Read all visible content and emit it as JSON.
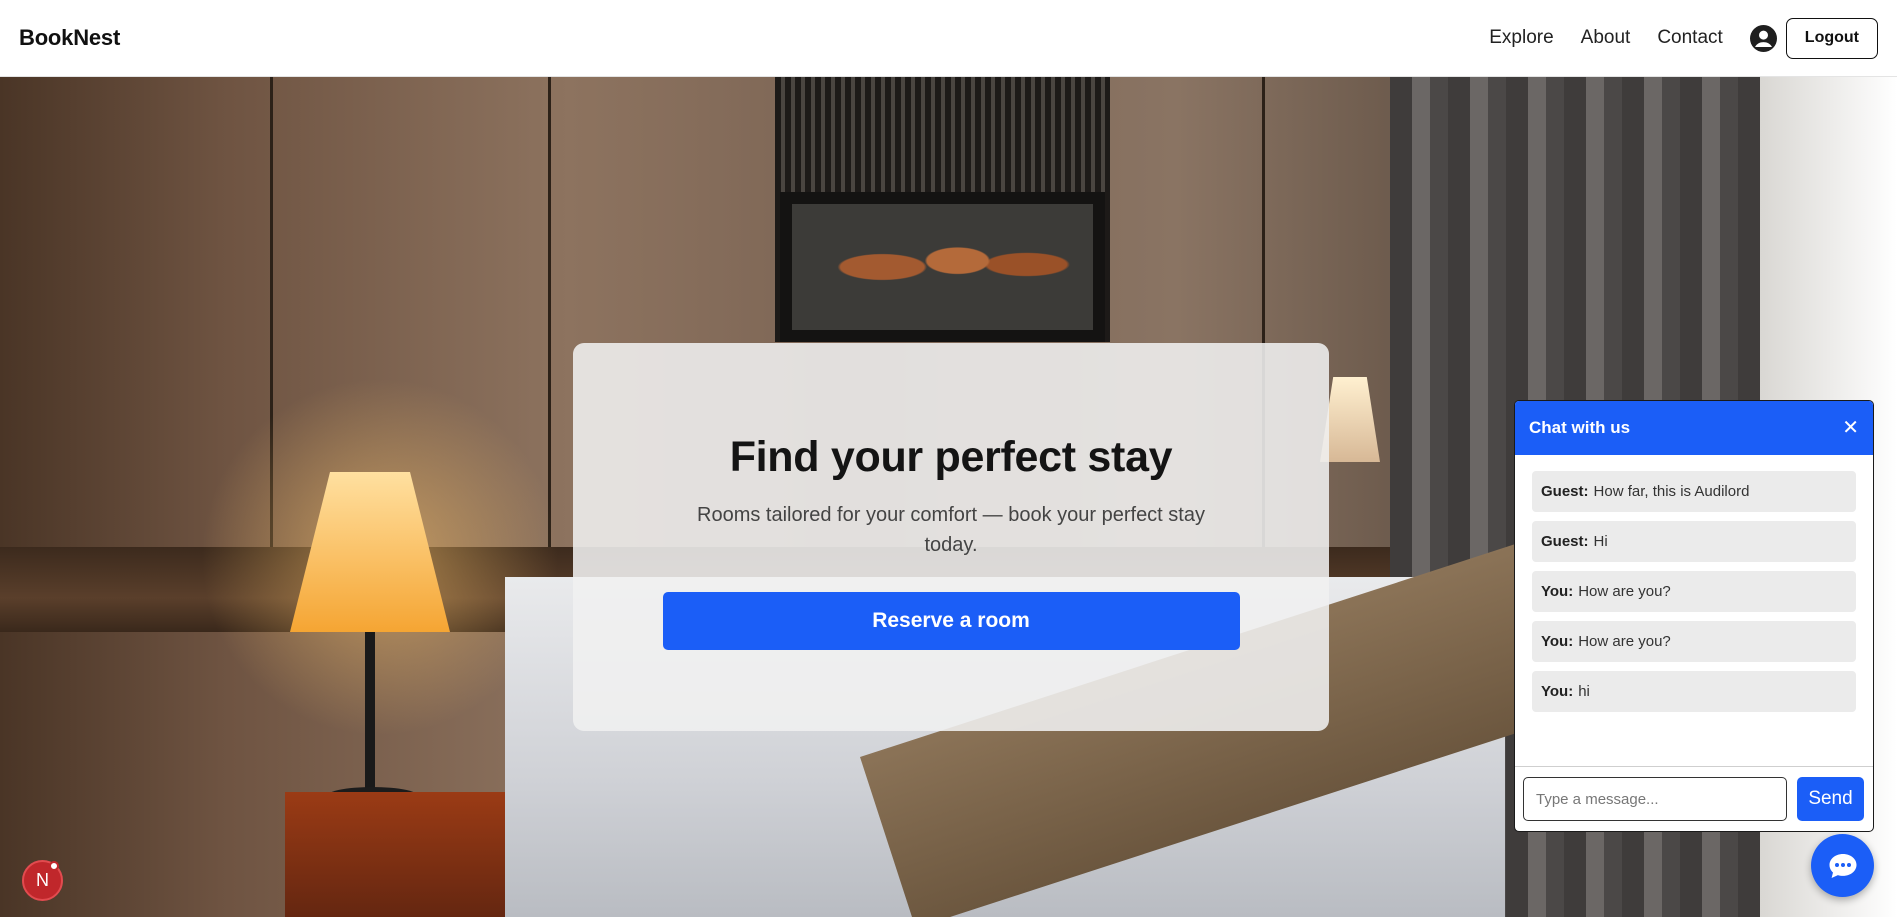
{
  "header": {
    "brand": "BookNest",
    "nav": [
      "Explore",
      "About",
      "Contact"
    ],
    "logout_label": "Logout"
  },
  "hero": {
    "title": "Find your perfect stay",
    "subtitle": "Rooms tailored for your comfort — book your perfect stay today.",
    "cta_label": "Reserve a room"
  },
  "chat": {
    "title": "Chat with us",
    "close_symbol": "✕",
    "messages": [
      {
        "sender": "Guest:",
        "text": "How far, this is Audilord"
      },
      {
        "sender": "Guest:",
        "text": "Hi"
      },
      {
        "sender": "You:",
        "text": "How are you?"
      },
      {
        "sender": "You:",
        "text": "How are you?"
      },
      {
        "sender": "You:",
        "text": "hi"
      }
    ],
    "input_placeholder": "Type a message...",
    "send_label": "Send"
  },
  "badge": {
    "letter": "N"
  },
  "icons": {
    "user": "user-circle-icon",
    "chat_fab": "chat-bubble-icon",
    "close": "close-icon"
  },
  "colors": {
    "accent": "#1b5ef7",
    "badge": "#c0272b"
  }
}
